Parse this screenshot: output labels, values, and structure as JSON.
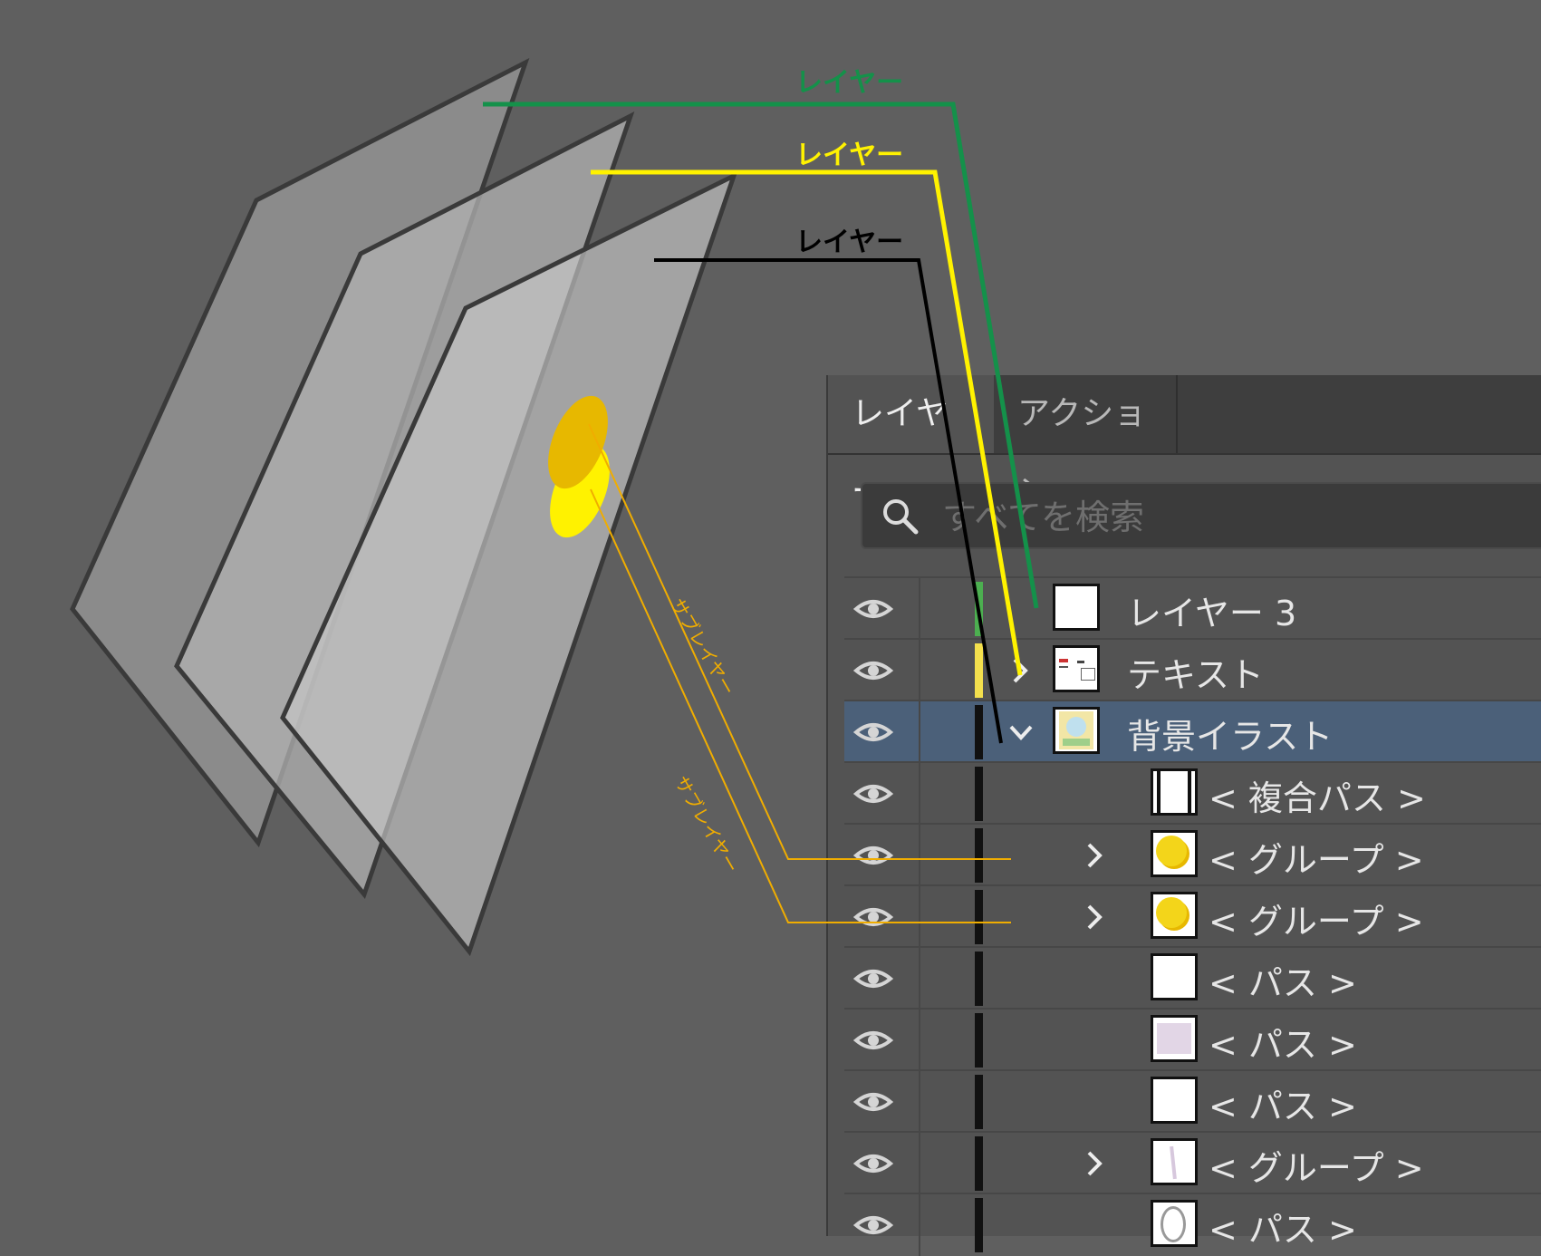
{
  "panel": {
    "tabs": [
      {
        "label": "レイヤー"
      },
      {
        "label": "アクション"
      }
    ],
    "search": {
      "placeholder": "すべてを検索",
      "icon": "search-icon"
    },
    "rows": [
      {
        "label": "レイヤー 3",
        "color": "#4caf50",
        "expander": "none",
        "thumb": "white",
        "selected": false
      },
      {
        "label": "テキスト",
        "color": "#f4e04d",
        "expander": "collapsed",
        "thumb": "text-thumb",
        "selected": false
      },
      {
        "label": "背景イラスト",
        "color": "#111111",
        "expander": "expanded",
        "thumb": "illustration-thumb",
        "selected": true
      },
      {
        "label": "< 複合パス >",
        "color": "#111111",
        "expander": "none",
        "thumb": "compound-thumb",
        "selected": false
      },
      {
        "label": "< グループ >",
        "color": "#111111",
        "expander": "collapsed",
        "thumb": "circle-thumb",
        "selected": false
      },
      {
        "label": "< グループ >",
        "color": "#111111",
        "expander": "collapsed",
        "thumb": "circle-thumb",
        "selected": false
      },
      {
        "label": "< パス >",
        "color": "#111111",
        "expander": "none",
        "thumb": "white",
        "selected": false
      },
      {
        "label": "< パス >",
        "color": "#111111",
        "expander": "none",
        "thumb": "lavender",
        "selected": false
      },
      {
        "label": "< パス >",
        "color": "#111111",
        "expander": "none",
        "thumb": "white",
        "selected": false
      },
      {
        "label": "< グループ >",
        "color": "#111111",
        "expander": "collapsed",
        "thumb": "stroke-thumb",
        "selected": false
      },
      {
        "label": "< パス >",
        "color": "#111111",
        "expander": "none",
        "thumb": "oval-thumb",
        "selected": false
      }
    ]
  },
  "diagram": {
    "labels": [
      {
        "text": "レイヤー",
        "color": "#14914a"
      },
      {
        "text": "レイヤー",
        "color": "#fff200"
      },
      {
        "text": "レイヤー",
        "color": "#000000"
      }
    ],
    "sublayer_labels": [
      {
        "text": "サブレイヤー",
        "color": "#f0ad00"
      },
      {
        "text": "サブレイヤー",
        "color": "#f0ad00"
      }
    ],
    "colors": {
      "green": "#14914a",
      "yellow": "#fff200",
      "black": "#000000",
      "orange": "#f0ad00"
    }
  }
}
